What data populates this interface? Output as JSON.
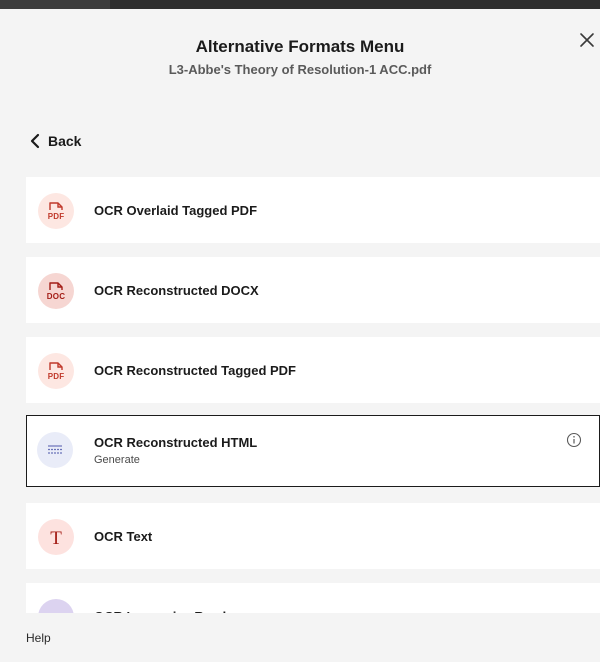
{
  "header": {
    "title": "Alternative Formats Menu",
    "subtitle": "L3-Abbe's Theory of Resolution-1 ACC.pdf"
  },
  "nav": {
    "back_label": "Back",
    "close_icon": "close-icon"
  },
  "items": [
    {
      "label": "OCR Overlaid Tagged PDF",
      "icon": "pdf-file-icon",
      "icon_text": "PDF",
      "icon_bg": "#fde7e2",
      "icon_color": "#c0392b"
    },
    {
      "label": "OCR Reconstructed DOCX",
      "icon": "doc-file-icon",
      "icon_text": "DOC",
      "icon_bg": "#f6d6d2",
      "icon_color": "#a31d16"
    },
    {
      "label": "OCR Reconstructed Tagged PDF",
      "icon": "pdf-file-icon",
      "icon_text": "PDF",
      "icon_bg": "#fde7e2",
      "icon_color": "#c0392b"
    },
    {
      "label": "OCR Reconstructed HTML",
      "sub": "Generate",
      "icon": "html-lines-icon",
      "icon_bg": "#e9ecf8",
      "icon_color": "#6a72b8",
      "selected": true
    },
    {
      "label": "OCR Text",
      "icon": "text-t-icon",
      "icon_text": "T",
      "icon_bg": "#fde2df",
      "icon_color": "#a31d16"
    },
    {
      "label": "OCR Immersive Reader",
      "icon": "immersive-reader-icon",
      "icon_text": ">>>",
      "icon_bg": "#dcd3f0",
      "icon_color": "#5a4aa0"
    }
  ],
  "footer": {
    "help_label": "Help"
  }
}
